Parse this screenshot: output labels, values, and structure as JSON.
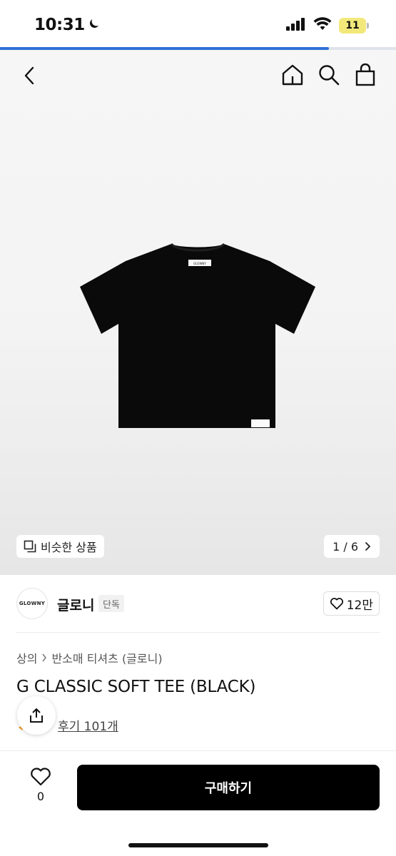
{
  "status_bar": {
    "time": "10:31",
    "battery": "11"
  },
  "progress": {
    "percent": 83
  },
  "image": {
    "brand_label": "GLOWNY",
    "similar_label": "비슷한 상품",
    "pager": "1 / 6"
  },
  "brand": {
    "logo_text": "GLOWNY",
    "name": "글로니",
    "tag": "단독",
    "likes": "12만"
  },
  "breadcrumb": {
    "level1": "상의",
    "level2": "반소매 티셔츠 (글로니)"
  },
  "product": {
    "title": "G CLASSIC SOFT TEE (BLACK)",
    "review": "후기 101개"
  },
  "bottom": {
    "wish_count": "0",
    "buy_label": "구매하기"
  },
  "colors": {
    "progress": "#2f6fd6",
    "buy_button": "#000000",
    "battery": "#f2e87a"
  }
}
